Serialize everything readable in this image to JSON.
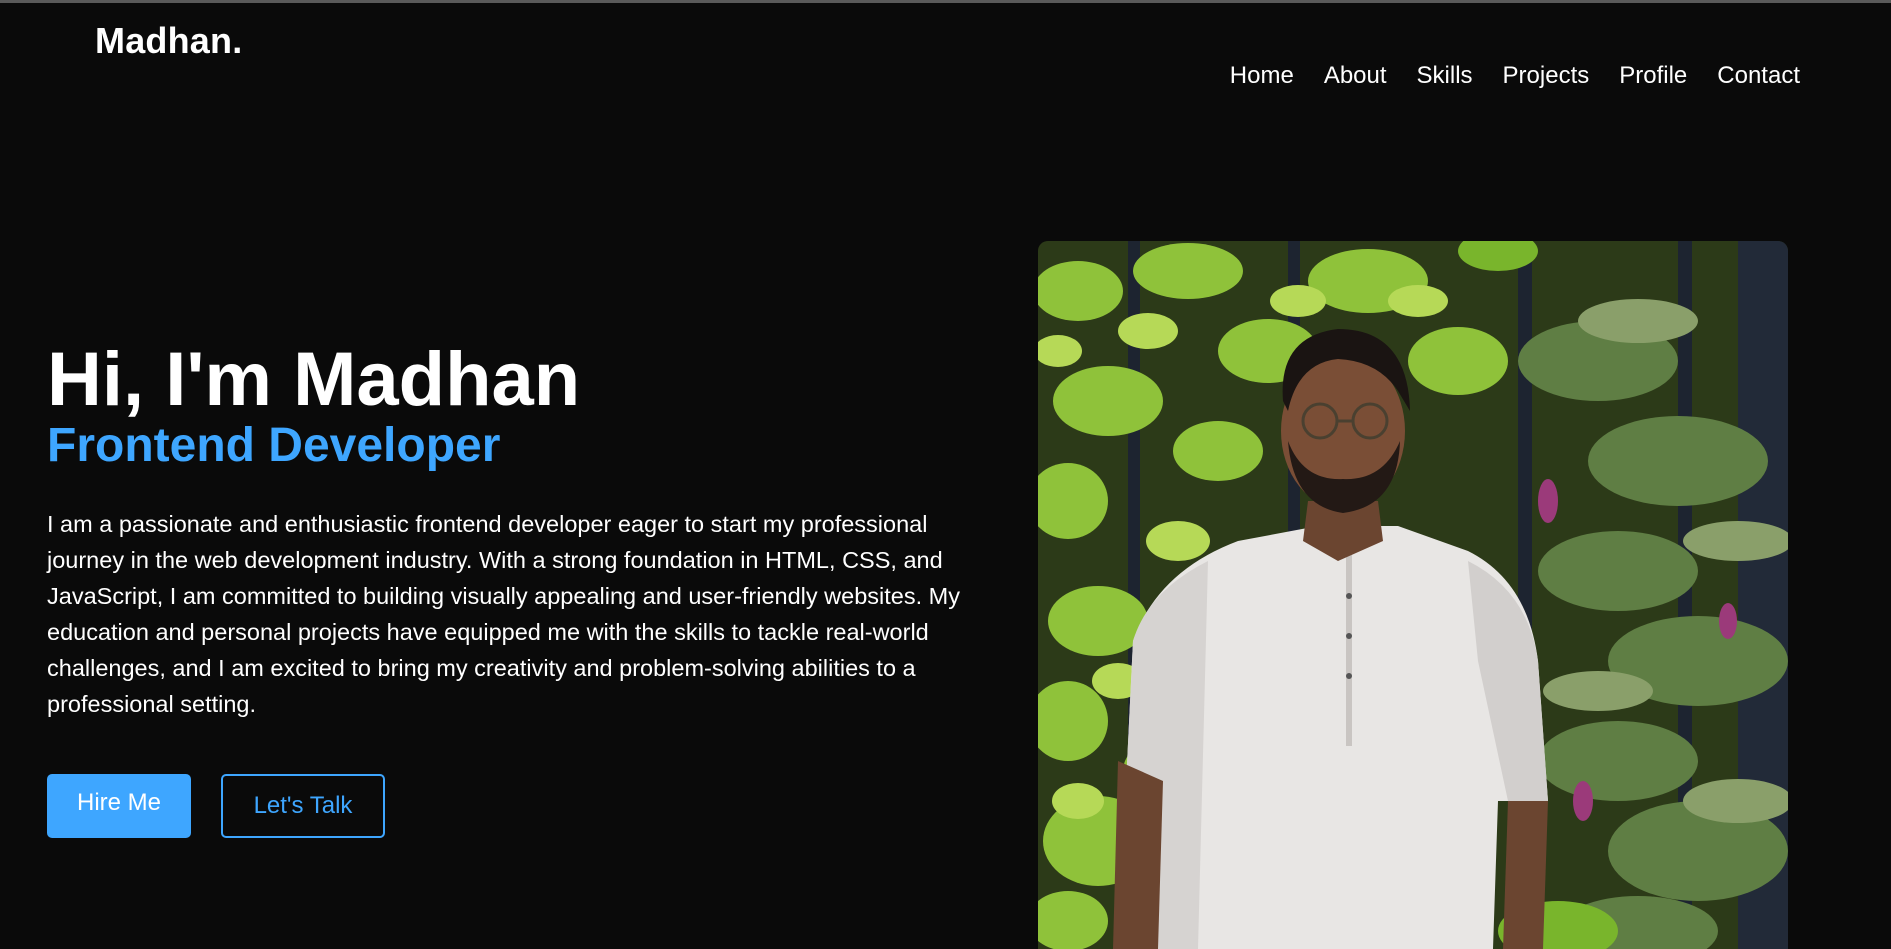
{
  "brand": {
    "logo": "Madhan."
  },
  "nav": {
    "items": [
      "Home",
      "About",
      "Skills",
      "Projects",
      "Profile",
      "Contact"
    ]
  },
  "hero": {
    "title": "Hi, I'm Madhan",
    "subtitle": "Frontend Developer",
    "description": "I am a passionate and enthusiastic frontend developer eager to start my professional journey in the web development industry. With a strong foundation in HTML, CSS, and JavaScript, I am committed to building visually appealing and user-friendly websites. My education and personal projects have equipped me with the skills to tackle real-world challenges, and I am excited to bring my creativity and problem-solving abilities to a professional setting.",
    "primary_button": "Hire Me",
    "secondary_button": "Let's Talk"
  },
  "colors": {
    "background": "#0a0a0a",
    "accent": "#3ea6ff",
    "text": "#ffffff"
  },
  "icons": {
    "portrait": "profile-photo"
  }
}
